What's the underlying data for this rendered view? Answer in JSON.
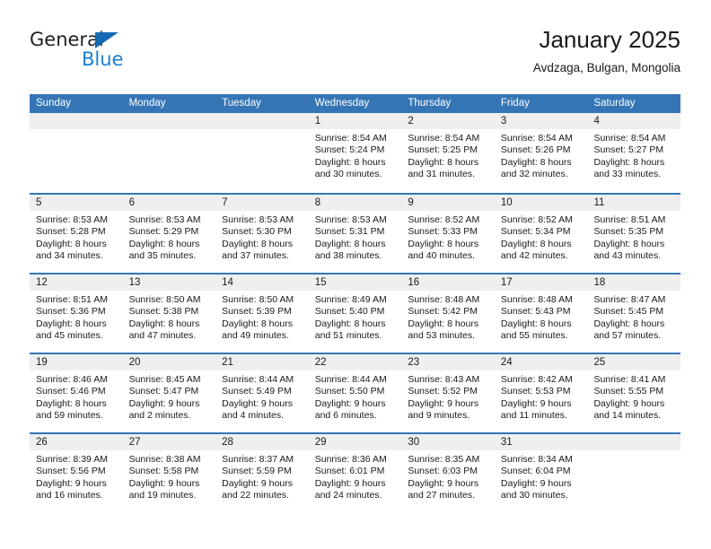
{
  "brand": {
    "name_top": "General",
    "name_bottom": "Blue",
    "triangle_color": "#1668b3",
    "blue_text_color": "#1a7fd4"
  },
  "header": {
    "title": "January 2025",
    "subtitle": "Avdzaga, Bulgan, Mongolia"
  },
  "theme": {
    "header_blue": "#3575b5",
    "day_band_gray": "#efefef",
    "text": "#1a1a1a"
  },
  "weekdays": [
    "Sunday",
    "Monday",
    "Tuesday",
    "Wednesday",
    "Thursday",
    "Friday",
    "Saturday"
  ],
  "labels": {
    "sunrise": "Sunrise:",
    "sunset": "Sunset:",
    "daylight": "Daylight:"
  },
  "weeks": [
    [
      {
        "day": "",
        "sunrise": "",
        "sunset": "",
        "daylight": ""
      },
      {
        "day": "",
        "sunrise": "",
        "sunset": "",
        "daylight": ""
      },
      {
        "day": "",
        "sunrise": "",
        "sunset": "",
        "daylight": ""
      },
      {
        "day": "1",
        "sunrise": "Sunrise: 8:54 AM",
        "sunset": "Sunset: 5:24 PM",
        "daylight": "Daylight: 8 hours and 30 minutes."
      },
      {
        "day": "2",
        "sunrise": "Sunrise: 8:54 AM",
        "sunset": "Sunset: 5:25 PM",
        "daylight": "Daylight: 8 hours and 31 minutes."
      },
      {
        "day": "3",
        "sunrise": "Sunrise: 8:54 AM",
        "sunset": "Sunset: 5:26 PM",
        "daylight": "Daylight: 8 hours and 32 minutes."
      },
      {
        "day": "4",
        "sunrise": "Sunrise: 8:54 AM",
        "sunset": "Sunset: 5:27 PM",
        "daylight": "Daylight: 8 hours and 33 minutes."
      }
    ],
    [
      {
        "day": "5",
        "sunrise": "Sunrise: 8:53 AM",
        "sunset": "Sunset: 5:28 PM",
        "daylight": "Daylight: 8 hours and 34 minutes."
      },
      {
        "day": "6",
        "sunrise": "Sunrise: 8:53 AM",
        "sunset": "Sunset: 5:29 PM",
        "daylight": "Daylight: 8 hours and 35 minutes."
      },
      {
        "day": "7",
        "sunrise": "Sunrise: 8:53 AM",
        "sunset": "Sunset: 5:30 PM",
        "daylight": "Daylight: 8 hours and 37 minutes."
      },
      {
        "day": "8",
        "sunrise": "Sunrise: 8:53 AM",
        "sunset": "Sunset: 5:31 PM",
        "daylight": "Daylight: 8 hours and 38 minutes."
      },
      {
        "day": "9",
        "sunrise": "Sunrise: 8:52 AM",
        "sunset": "Sunset: 5:33 PM",
        "daylight": "Daylight: 8 hours and 40 minutes."
      },
      {
        "day": "10",
        "sunrise": "Sunrise: 8:52 AM",
        "sunset": "Sunset: 5:34 PM",
        "daylight": "Daylight: 8 hours and 42 minutes."
      },
      {
        "day": "11",
        "sunrise": "Sunrise: 8:51 AM",
        "sunset": "Sunset: 5:35 PM",
        "daylight": "Daylight: 8 hours and 43 minutes."
      }
    ],
    [
      {
        "day": "12",
        "sunrise": "Sunrise: 8:51 AM",
        "sunset": "Sunset: 5:36 PM",
        "daylight": "Daylight: 8 hours and 45 minutes."
      },
      {
        "day": "13",
        "sunrise": "Sunrise: 8:50 AM",
        "sunset": "Sunset: 5:38 PM",
        "daylight": "Daylight: 8 hours and 47 minutes."
      },
      {
        "day": "14",
        "sunrise": "Sunrise: 8:50 AM",
        "sunset": "Sunset: 5:39 PM",
        "daylight": "Daylight: 8 hours and 49 minutes."
      },
      {
        "day": "15",
        "sunrise": "Sunrise: 8:49 AM",
        "sunset": "Sunset: 5:40 PM",
        "daylight": "Daylight: 8 hours and 51 minutes."
      },
      {
        "day": "16",
        "sunrise": "Sunrise: 8:48 AM",
        "sunset": "Sunset: 5:42 PM",
        "daylight": "Daylight: 8 hours and 53 minutes."
      },
      {
        "day": "17",
        "sunrise": "Sunrise: 8:48 AM",
        "sunset": "Sunset: 5:43 PM",
        "daylight": "Daylight: 8 hours and 55 minutes."
      },
      {
        "day": "18",
        "sunrise": "Sunrise: 8:47 AM",
        "sunset": "Sunset: 5:45 PM",
        "daylight": "Daylight: 8 hours and 57 minutes."
      }
    ],
    [
      {
        "day": "19",
        "sunrise": "Sunrise: 8:46 AM",
        "sunset": "Sunset: 5:46 PM",
        "daylight": "Daylight: 8 hours and 59 minutes."
      },
      {
        "day": "20",
        "sunrise": "Sunrise: 8:45 AM",
        "sunset": "Sunset: 5:47 PM",
        "daylight": "Daylight: 9 hours and 2 minutes."
      },
      {
        "day": "21",
        "sunrise": "Sunrise: 8:44 AM",
        "sunset": "Sunset: 5:49 PM",
        "daylight": "Daylight: 9 hours and 4 minutes."
      },
      {
        "day": "22",
        "sunrise": "Sunrise: 8:44 AM",
        "sunset": "Sunset: 5:50 PM",
        "daylight": "Daylight: 9 hours and 6 minutes."
      },
      {
        "day": "23",
        "sunrise": "Sunrise: 8:43 AM",
        "sunset": "Sunset: 5:52 PM",
        "daylight": "Daylight: 9 hours and 9 minutes."
      },
      {
        "day": "24",
        "sunrise": "Sunrise: 8:42 AM",
        "sunset": "Sunset: 5:53 PM",
        "daylight": "Daylight: 9 hours and 11 minutes."
      },
      {
        "day": "25",
        "sunrise": "Sunrise: 8:41 AM",
        "sunset": "Sunset: 5:55 PM",
        "daylight": "Daylight: 9 hours and 14 minutes."
      }
    ],
    [
      {
        "day": "26",
        "sunrise": "Sunrise: 8:39 AM",
        "sunset": "Sunset: 5:56 PM",
        "daylight": "Daylight: 9 hours and 16 minutes."
      },
      {
        "day": "27",
        "sunrise": "Sunrise: 8:38 AM",
        "sunset": "Sunset: 5:58 PM",
        "daylight": "Daylight: 9 hours and 19 minutes."
      },
      {
        "day": "28",
        "sunrise": "Sunrise: 8:37 AM",
        "sunset": "Sunset: 5:59 PM",
        "daylight": "Daylight: 9 hours and 22 minutes."
      },
      {
        "day": "29",
        "sunrise": "Sunrise: 8:36 AM",
        "sunset": "Sunset: 6:01 PM",
        "daylight": "Daylight: 9 hours and 24 minutes."
      },
      {
        "day": "30",
        "sunrise": "Sunrise: 8:35 AM",
        "sunset": "Sunset: 6:03 PM",
        "daylight": "Daylight: 9 hours and 27 minutes."
      },
      {
        "day": "31",
        "sunrise": "Sunrise: 8:34 AM",
        "sunset": "Sunset: 6:04 PM",
        "daylight": "Daylight: 9 hours and 30 minutes."
      },
      {
        "day": "",
        "sunrise": "",
        "sunset": "",
        "daylight": ""
      }
    ]
  ]
}
